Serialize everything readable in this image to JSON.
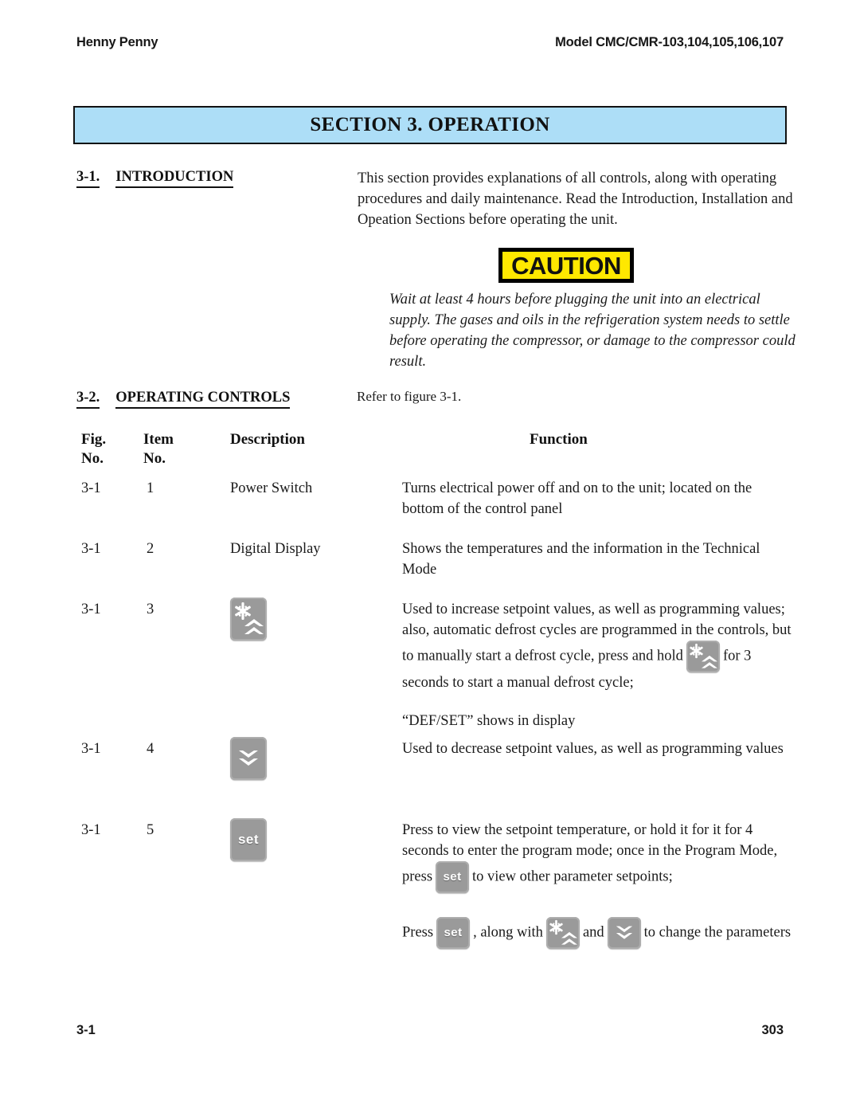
{
  "header": {
    "left": "Henny Penny",
    "right": "Model CMC/CMR-103,104,105,106,107"
  },
  "section_banner": {
    "title": "SECTION 3.  OPERATION",
    "background_color": "#ADDEF7",
    "border_color": "#111111"
  },
  "introduction": {
    "number": "3-1.",
    "label": "INTRODUCTION",
    "body": "This section provides explanations of all controls, along with operating procedures and daily maintenance.  Read the Introduction, Installation and Opeation Sections before operating the unit."
  },
  "caution": {
    "word": "CAUTION",
    "background_color": "#FFE800",
    "border_color": "#000000",
    "text": "Wait at least 4 hours before plugging the unit into an electrical supply.  The gases and oils in the refrigeration system needs to settle before operating the compressor, or damage to the compressor could result."
  },
  "operating_controls": {
    "number": "3-2.",
    "label": "OPERATING CONTROLS",
    "refer_note": "Refer to figure 3-1."
  },
  "table": {
    "headers": {
      "fig": {
        "line1": "Fig.",
        "line2": "No."
      },
      "item": {
        "line1": "Item",
        "line2": "No."
      },
      "description": {
        "line1": "Description",
        "line2": ""
      },
      "function": {
        "line1": "Function",
        "line2": ""
      }
    },
    "rows": [
      {
        "fig_no": "3-1",
        "item_no": "1",
        "description": "Power Switch",
        "description_icon": null,
        "function": "Turns electrical power off and on to the unit; located on the bottom of the control panel"
      },
      {
        "fig_no": "3-1",
        "item_no": "2",
        "description": "Digital Display",
        "description_icon": null,
        "function": "Shows the temperatures and the information in the Technical Mode"
      },
      {
        "fig_no": "3-1",
        "item_no": "3",
        "description": "",
        "description_icon": "defrost-up-key-icon",
        "function_part1": "Used to increase setpoint values, as well as programming values;  also, automatic defrost cycles are programmed in the controls, but to manually start a defrost cycle, press and hold",
        "function_part2": "for 3 seconds to start a manual defrost cycle;",
        "function_part3": "“DEF/SET” shows in display"
      },
      {
        "fig_no": "3-1",
        "item_no": "4",
        "description": "",
        "description_icon": "down-arrow-key-icon",
        "function": "Used to decrease setpoint values, as well as programming values"
      },
      {
        "fig_no": "3-1",
        "item_no": "5",
        "description": "",
        "description_icon": "set-key-icon",
        "function_part1": "Press to view the setpoint temperature, or hold it for it for 4 seconds to enter the program mode; once in the Program Mode, press",
        "function_part2": "to view other parameter setpoints;",
        "function_part3_a": "Press",
        "function_part3_b": ", along with",
        "function_part3_c": "and",
        "function_part3_d": "to change the parameters"
      }
    ]
  },
  "keys": {
    "set_label": "set",
    "key_color": "#9a9a9a",
    "glyph_color": "#ffffff"
  },
  "footer": {
    "left": "3-1",
    "right": "303"
  }
}
